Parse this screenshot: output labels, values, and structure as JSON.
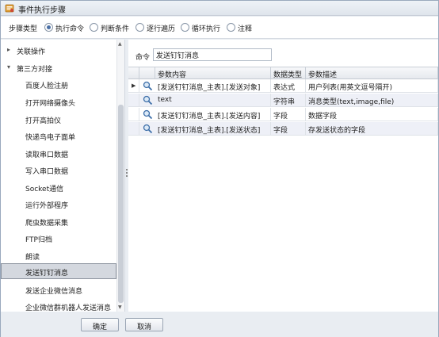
{
  "window": {
    "title": "事件执行步骤"
  },
  "step_type": {
    "label": "步骤类型",
    "options": [
      {
        "label": "执行命令",
        "selected": true
      },
      {
        "label": "判断条件",
        "selected": false
      },
      {
        "label": "逐行遍历",
        "selected": false
      },
      {
        "label": "循环执行",
        "selected": false
      },
      {
        "label": "注释",
        "selected": false
      }
    ]
  },
  "tree": {
    "groups": [
      {
        "label": "关联操作",
        "expanded": false
      },
      {
        "label": "第三方对接",
        "expanded": true
      }
    ],
    "items": [
      "百度人脸注册",
      "打开网络摄像头",
      "打开高拍仪",
      "快递鸟电子面单",
      "读取串口数据",
      "写入串口数据",
      "Socket通信",
      "运行外部程序",
      "爬虫数据采集",
      "FTP归档",
      "朗读",
      "发送钉钉消息",
      "发送企业微信消息",
      "企业微信群机器人发送消息"
    ],
    "selected_item": "发送钉钉消息"
  },
  "command": {
    "label": "命令",
    "value": "发送钉钉消息"
  },
  "grid": {
    "columns": [
      "参数内容",
      "数据类型",
      "参数描述"
    ],
    "rows": [
      {
        "content": "[发送钉钉消息_主表].[发送对象]",
        "type": "表达式",
        "desc": "用户列表(用英文逗号隔开)",
        "current": true
      },
      {
        "content": "text",
        "type": "字符串",
        "desc": "消息类型(text,image,file)",
        "current": false
      },
      {
        "content": "[发送钉钉消息_主表].[发送内容]",
        "type": "字段",
        "desc": "数据字段",
        "current": false
      },
      {
        "content": "[发送钉钉消息_主表].[发送状态]",
        "type": "字段",
        "desc": "存发送状态的字段",
        "current": false
      }
    ]
  },
  "buttons": {
    "ok": "确定",
    "cancel": "取消"
  },
  "colors": {
    "accent": "#4a6fa5",
    "selection": "#d4d8df",
    "row_alt": "#eef0f7"
  },
  "icons": {
    "title": "app-icon",
    "row_button": "search-icon",
    "expand": "triangle-right-icon",
    "collapse": "triangle-down-icon"
  }
}
